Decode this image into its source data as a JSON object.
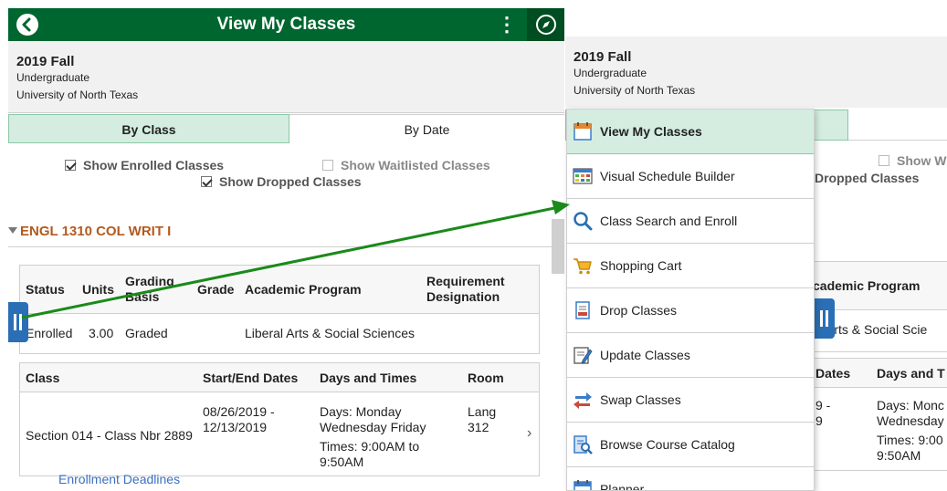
{
  "header": {
    "title": "View My Classes",
    "kebab": "⋮"
  },
  "term": {
    "name": "2019 Fall",
    "career": "Undergraduate",
    "institution": "University of North Texas"
  },
  "tabs": [
    {
      "label": "By Class",
      "active": true
    },
    {
      "label": "By Date",
      "active": false
    }
  ],
  "filters": {
    "enrolled": {
      "label": "Show Enrolled Classes",
      "checked": true
    },
    "waitlisted": {
      "label": "Show Waitlisted Classes",
      "checked": false
    },
    "dropped": {
      "label": "Show Dropped Classes",
      "checked": true
    }
  },
  "course": {
    "title": "ENGL 1310 COL WRIT I",
    "status_headers": [
      "Status",
      "Units",
      "Grading Basis",
      "Grade",
      "Academic Program",
      "Requirement Designation"
    ],
    "status_row": {
      "status": "Enrolled",
      "units": "3.00",
      "grading": "Graded",
      "grade": "",
      "program": "Liberal Arts & Social Sciences",
      "requirement": ""
    },
    "class_headers": [
      "Class",
      "Start/End Dates",
      "Days and Times",
      "Room"
    ],
    "class_row": {
      "class": "Section 014 - Class Nbr 2889",
      "dates": "08/26/2019 - 12/13/2019",
      "days": "Days: Monday Wednesday Friday",
      "times": "Times: 9:00AM to 9:50AM",
      "room": "Lang 312"
    },
    "link": "Enrollment Deadlines"
  },
  "right_panel": {
    "filter_waitlisted_partial": "Show W",
    "filter_dropped_partial": "Dropped Classes",
    "program_header_partial": "cademic Program",
    "program_value_partial": "al Arts & Social Scie",
    "dates_header_partial": "Dates",
    "days_header_partial": "Days and T",
    "dates_value_partial_1": "9 -",
    "dates_value_partial_2": "9",
    "days_value_partial_1": "Days: Monc",
    "days_value_partial_2": "Wednesday",
    "times_value_partial_1": "Times: 9:00",
    "times_value_partial_2": "9:50AM"
  },
  "menu": {
    "items": [
      {
        "label": "View My Classes",
        "icon": "calendar-icon",
        "active": true
      },
      {
        "label": "Visual Schedule Builder",
        "icon": "schedule-builder-icon",
        "active": false
      },
      {
        "label": "Class Search and Enroll",
        "icon": "search-icon",
        "active": false
      },
      {
        "label": "Shopping Cart",
        "icon": "shopping-cart-icon",
        "active": false
      },
      {
        "label": "Drop Classes",
        "icon": "drop-classes-icon",
        "active": false
      },
      {
        "label": "Update Classes",
        "icon": "update-classes-icon",
        "active": false
      },
      {
        "label": "Swap Classes",
        "icon": "swap-icon",
        "active": false
      },
      {
        "label": "Browse Course Catalog",
        "icon": "catalog-icon",
        "active": false
      },
      {
        "label": "Planner",
        "icon": "planner-icon",
        "active": false
      }
    ]
  },
  "colors": {
    "header_green": "#006630",
    "active_tab": "#d4ede0",
    "course_title": "#b35a1f",
    "link_blue": "#3b6fc2",
    "handle_blue": "#2a6fb5",
    "arrow_green": "#1a8a1a"
  }
}
